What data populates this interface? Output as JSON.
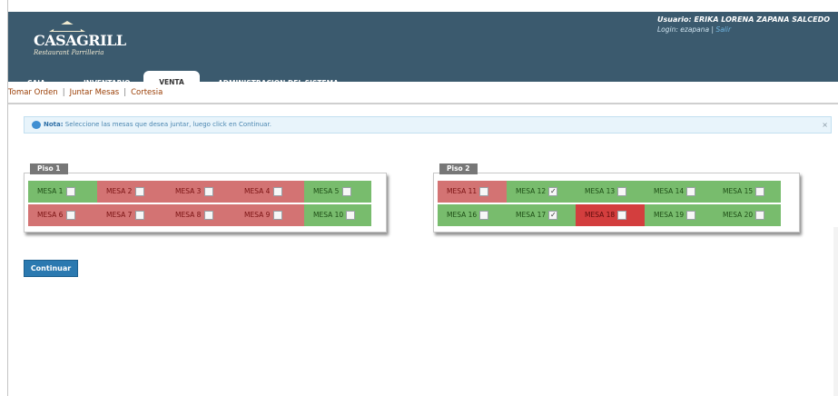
{
  "header": {
    "logo": {
      "brand": "CASAGRILL",
      "tagline": "Restaurant Parrilleria"
    },
    "user": {
      "name": "Usuario: ERIKA LORENA ZAPANA SALCEDO",
      "login_prefix": "Login: ezapana |",
      "logout": "Salir"
    },
    "nav": [
      {
        "label": "CAJA"
      },
      {
        "label": "INVENTARIO"
      },
      {
        "label": "VENTA",
        "active": true
      },
      {
        "label": "ADMINISTRACION DEL SISTEMA"
      }
    ]
  },
  "subnav": {
    "items": [
      "Tomar Orden",
      "Juntar Mesas",
      "Cortesia"
    ]
  },
  "note": {
    "label": "Nota:",
    "text": "Seleccione las mesas que desea juntar, luego click en Continuar.",
    "close": "×"
  },
  "floors": [
    {
      "title": "Piso 1",
      "tables": [
        {
          "label": "MESA 1",
          "status": "free",
          "checked": false
        },
        {
          "label": "MESA 2",
          "status": "busy",
          "checked": false
        },
        {
          "label": "MESA 3",
          "status": "busy",
          "checked": false
        },
        {
          "label": "MESA 4",
          "status": "busy",
          "checked": false
        },
        {
          "label": "MESA 5",
          "status": "free",
          "checked": false
        },
        {
          "label": "MESA 6",
          "status": "busy",
          "checked": false
        },
        {
          "label": "MESA 7",
          "status": "busy",
          "checked": false
        },
        {
          "label": "MESA 8",
          "status": "busy",
          "checked": false
        },
        {
          "label": "MESA 9",
          "status": "busy",
          "checked": false
        },
        {
          "label": "MESA 10",
          "status": "free",
          "checked": false
        }
      ]
    },
    {
      "title": "Piso 2",
      "tables": [
        {
          "label": "MESA 11",
          "status": "busy",
          "checked": false
        },
        {
          "label": "MESA 12",
          "status": "free",
          "checked": true
        },
        {
          "label": "MESA 13",
          "status": "free",
          "checked": false
        },
        {
          "label": "MESA 14",
          "status": "free",
          "checked": false
        },
        {
          "label": "MESA 15",
          "status": "free",
          "checked": false
        },
        {
          "label": "MESA 16",
          "status": "free",
          "checked": false
        },
        {
          "label": "MESA 17",
          "status": "free",
          "checked": true
        },
        {
          "label": "MESA 18",
          "status": "busy-strong",
          "checked": false
        },
        {
          "label": "MESA 19",
          "status": "free",
          "checked": false
        },
        {
          "label": "MESA 20",
          "status": "free",
          "checked": false
        }
      ]
    }
  ],
  "actions": {
    "continue_label": "Continuar"
  },
  "colors": {
    "header": "#3b5a6e",
    "free": "#78bc6d",
    "busy": "#d37373",
    "busy_strong": "#d33e3e",
    "button": "#2b79b0"
  }
}
